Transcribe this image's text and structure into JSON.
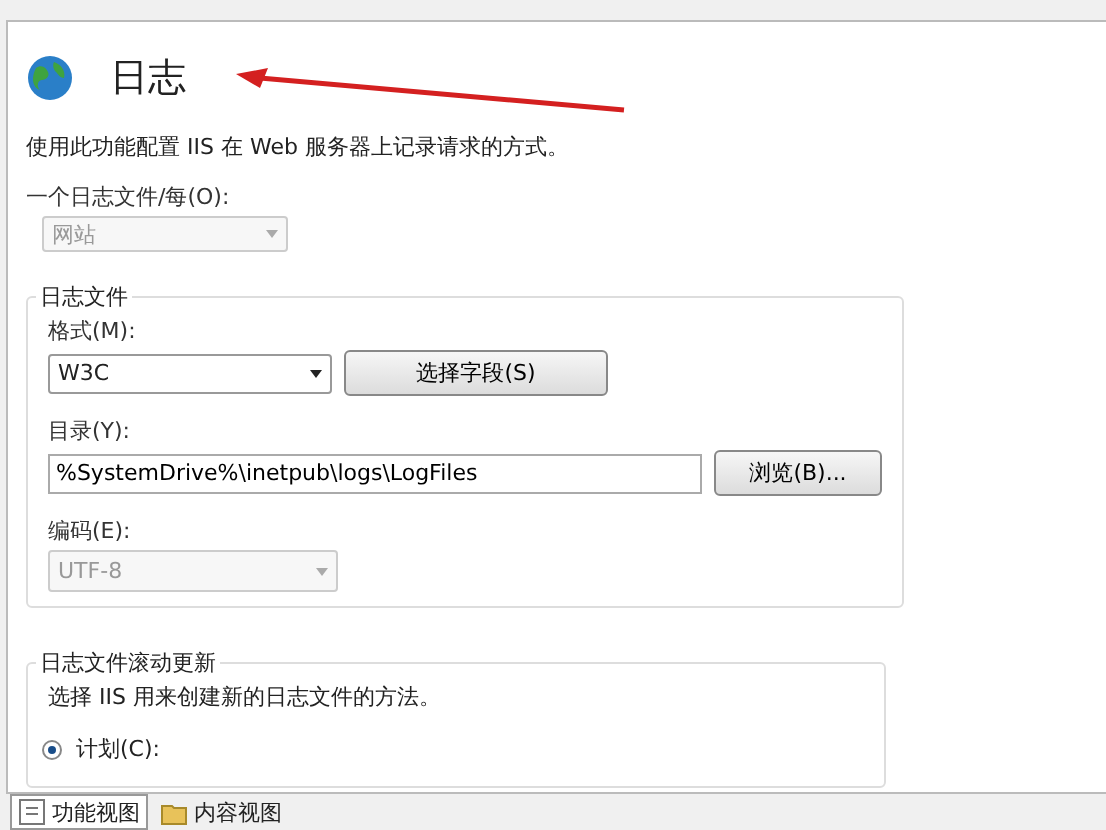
{
  "header": {
    "title": "日志",
    "description": "使用此功能配置 IIS 在 Web 服务器上记录请求的方式。"
  },
  "one_log_per": {
    "label": "一个日志文件/每(O):",
    "value": "网站",
    "disabled": true
  },
  "log_file_group": {
    "title": "日志文件",
    "format": {
      "label": "格式(M):",
      "value": "W3C",
      "disabled": false
    },
    "select_fields_button": "选择字段(S)",
    "directory": {
      "label": "目录(Y):",
      "value": "%SystemDrive%\\inetpub\\logs\\LogFiles"
    },
    "browse_button": "浏览(B)...",
    "encoding": {
      "label": "编码(E):",
      "value": "UTF-8",
      "disabled": true
    }
  },
  "rollover_group": {
    "title": "日志文件滚动更新",
    "description": "选择 IIS 用来创建新的日志文件的方法。",
    "options": [
      {
        "label": "计划(C):",
        "selected": true
      }
    ]
  },
  "view_tabs": [
    {
      "label": "功能视图",
      "selected": true
    },
    {
      "label": "内容视图",
      "selected": false
    }
  ]
}
